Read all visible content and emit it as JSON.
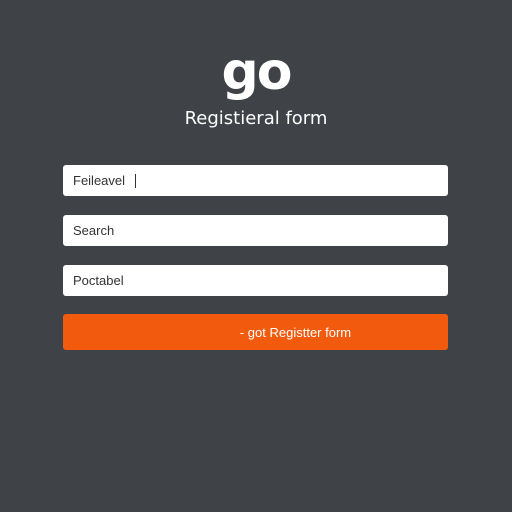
{
  "logo": {
    "text": "go"
  },
  "form": {
    "title": "Registieral form",
    "fields": [
      {
        "value": "Feileavel"
      },
      {
        "value": "Search"
      },
      {
        "value": "Poctabel"
      }
    ],
    "submit_label": "- got Registter form"
  },
  "colors": {
    "background": "#3f4247",
    "field_background": "#ffffff",
    "submit_accent": "#f25a0d"
  }
}
